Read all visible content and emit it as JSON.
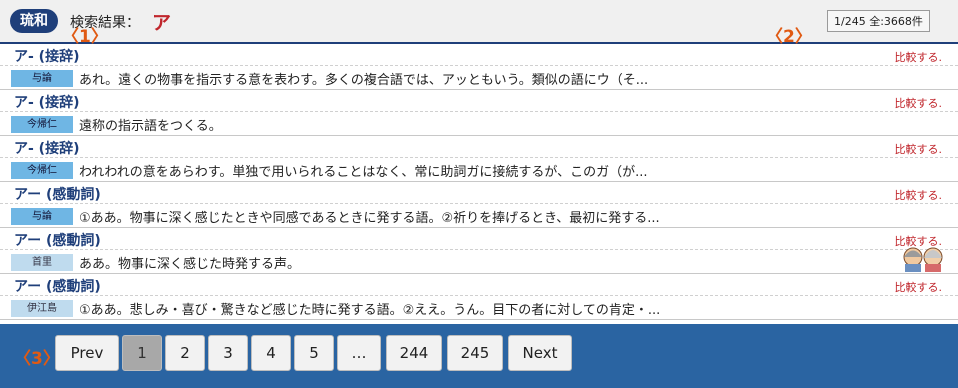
{
  "header": {
    "logo": "琉和",
    "search_label": "検索結果：",
    "search_term": "ア",
    "counter": "1/245 全:3668件",
    "markers": [
      "〈1〉",
      "〈2〉",
      "〈3〉"
    ]
  },
  "entries": [
    {
      "headword": "ア- (接辞)",
      "compare": "比較する.",
      "dialect": "与論",
      "meaning": "あれ。遠くの物事を指示する意を表わす。多くの複合語では、アッともいう。類似の語にウ（そ..."
    },
    {
      "headword": "ア- (接辞)",
      "compare": "比較する.",
      "dialect": "今帰仁",
      "meaning": "遠称の指示語をつくる。"
    },
    {
      "headword": "ア- (接辞)",
      "compare": "比較する.",
      "dialect": "今帰仁",
      "meaning": "われわれの意をあらわす。単独で用いられることはなく、常に助詞ガに接続するが、このガ（が..."
    },
    {
      "headword": "アー (感動詞)",
      "compare": "比較する.",
      "dialect": "与論",
      "meaning": "①ああ。物事に深く感じたときや同感であるときに発する語。②祈りを捧げるとき、最初に発する..."
    },
    {
      "headword": "アー (感動詞)",
      "compare": "比較する.",
      "dialect": "首里",
      "meaning": "ああ。物事に深く感じた時発する声。"
    },
    {
      "headword": "アー (感動詞)",
      "compare": "比較する.",
      "dialect": "伊江島",
      "meaning": "①ああ。悲しみ・喜び・驚きなど感じた時に発する語。②ええ。うん。目下の者に対しての肯定・..."
    }
  ],
  "pagination": {
    "prev": "Prev",
    "pages": [
      "1",
      "2",
      "3",
      "4",
      "5",
      "…",
      "244",
      "245"
    ],
    "next": "Next",
    "current": "1"
  }
}
